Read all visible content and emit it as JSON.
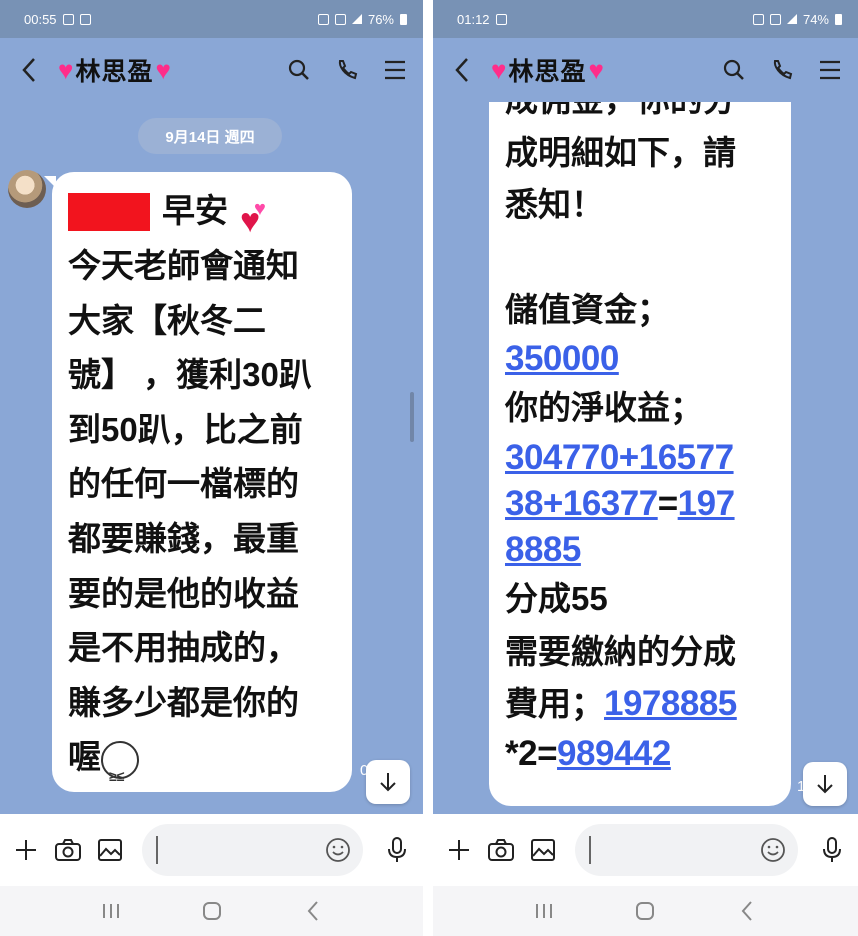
{
  "left": {
    "status": {
      "time": "00:55",
      "battery": "76%"
    },
    "header": {
      "title": "林思盈"
    },
    "date_pill": "9月14日 週四",
    "message": {
      "greeting": "早安",
      "lines": [
        "今天老師會通知",
        "大家【秋冬二",
        "號】 ，獲利30趴",
        "到50趴，比之前",
        "的任何一檔標的",
        "都要賺錢，最重",
        "要的是他的收益",
        "是不用抽成的，",
        "賺多少都是你的",
        "喔"
      ]
    },
    "side_meta": "0"
  },
  "right": {
    "status": {
      "time": "01:12",
      "battery": "74%"
    },
    "header": {
      "title": "林思盈"
    },
    "message": {
      "clipped_top": "成佣金，你的分",
      "line1": "成明細如下，請",
      "line2": "悉知！",
      "deposit_label": "儲值資金；",
      "deposit_value": "350000",
      "net_label": "你的淨收益；",
      "net_formula_a": "304770+16577",
      "net_formula_b": "38+16377",
      "net_equals": "=",
      "net_result_a": "197",
      "net_result_b": "8885",
      "split_label": "分成55",
      "fee_label_a": "需要繳納的分成",
      "fee_label_b": "費用；",
      "fee_value": "1978885",
      "fee_formula_prefix": "*2=",
      "fee_result": "989442"
    },
    "side_meta": "1"
  },
  "colors": {
    "chat_bg": "#8aa7d6",
    "header_bg": "#7892b5",
    "link": "#3b61e8",
    "redact": "#f2141e",
    "heart": "#ff2d8a"
  }
}
